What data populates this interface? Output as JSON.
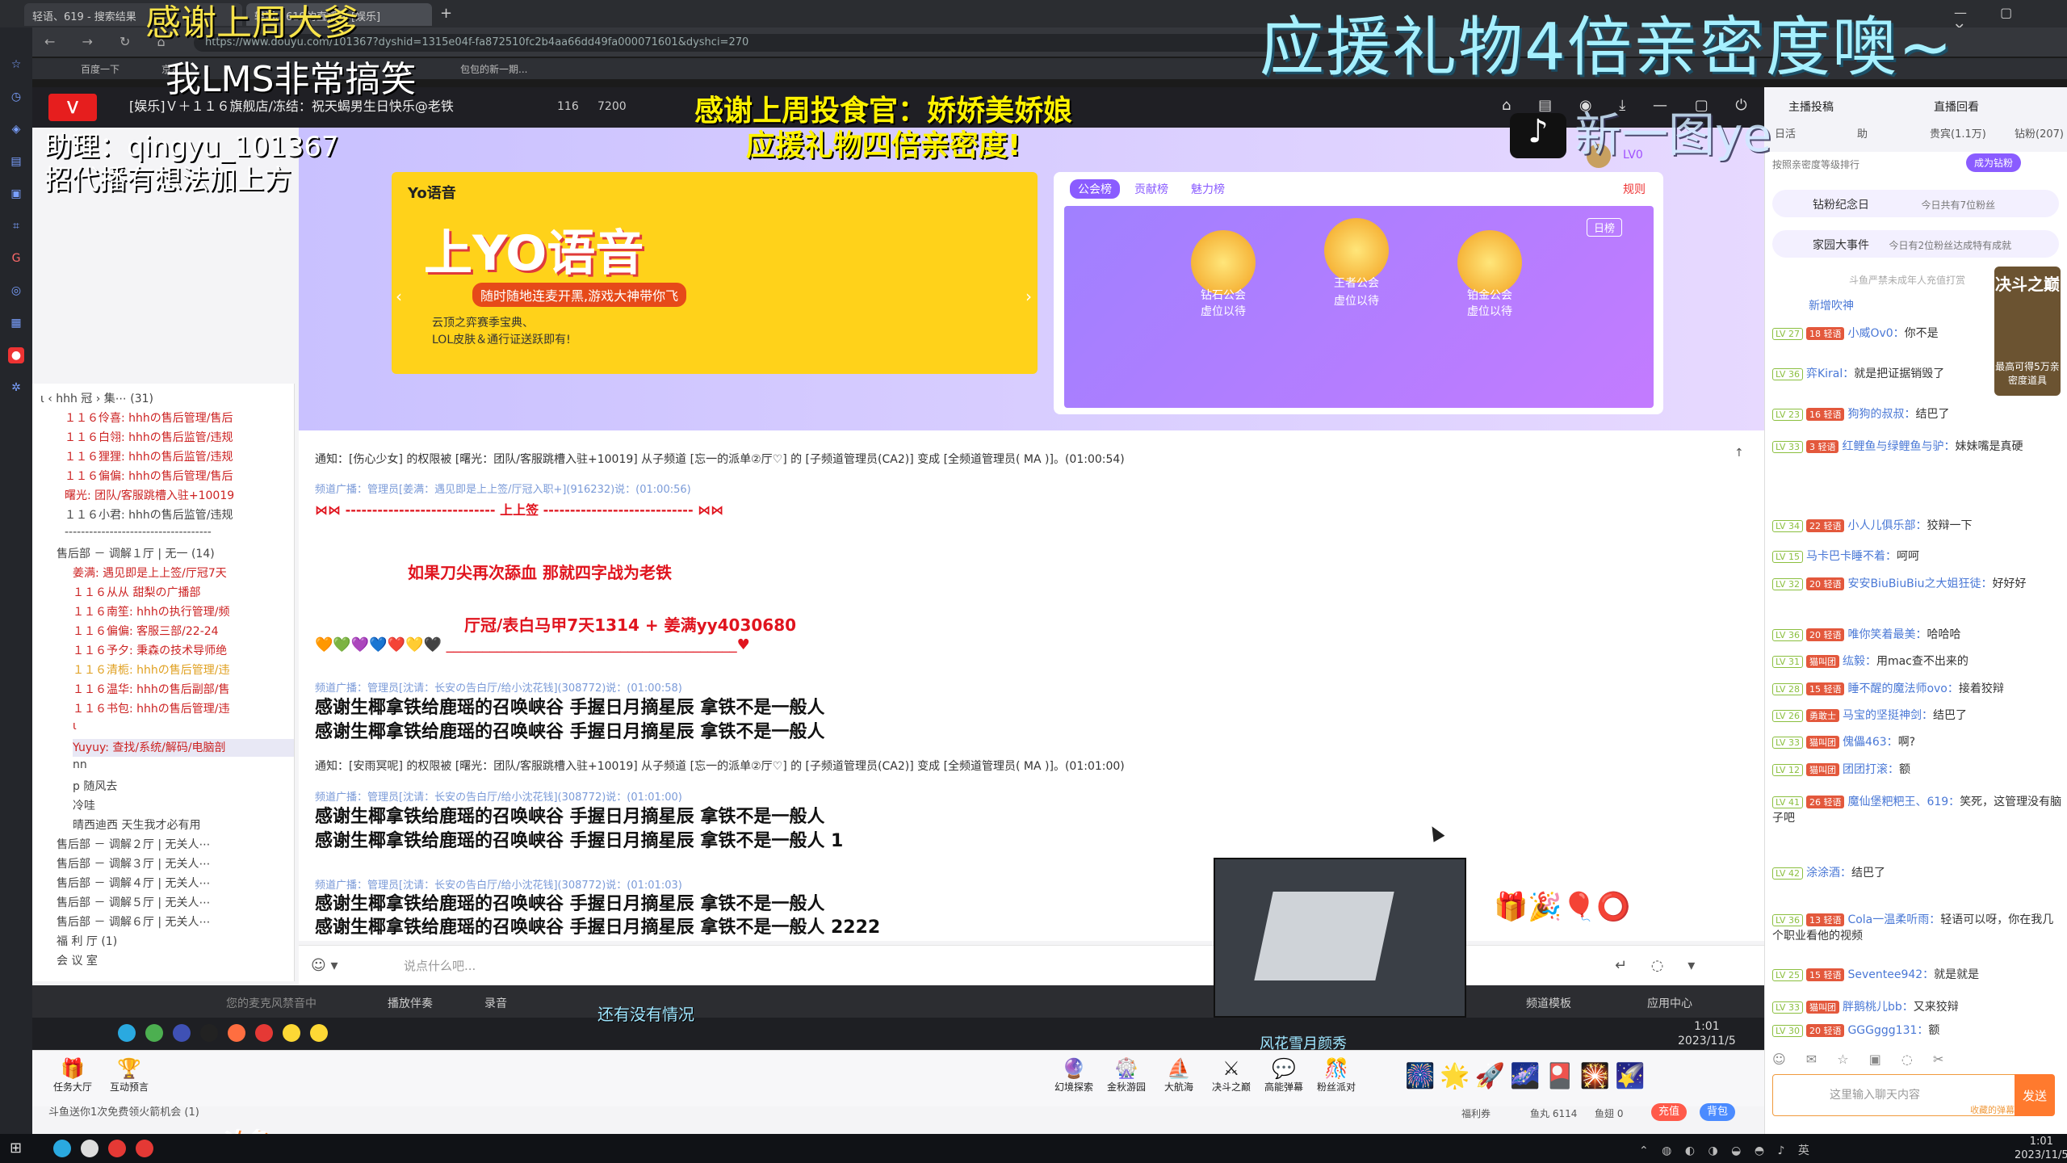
{
  "browser": {
    "tabs": [
      "轻语、619 - 搜索结果",
      "轻语、619的直播间 [娱乐]"
    ],
    "url": "https://www.douyu.com/101367?dyshid=1315e04f-fa872510fc2b4aa66dd49fa000071601&dyshci=270",
    "bookmarks": [
      "百度一下",
      "京东",
      "包包的新一期..."
    ]
  },
  "overlays": {
    "top_left_line1": "感谢上周大爹",
    "top_left_line2": "我LMS非常搞笑",
    "top_right": "应援礼物4倍亲密度噢~",
    "banner_line1": "感谢上周投食官：娇娇美娇娘",
    "banner_line2": "应援礼物四倍亲密度!",
    "assistant_line1": "助理：qingyu_101367",
    "assistant_line2": "招代播有想法加上方",
    "tiktok_text": "新一图ye",
    "subtitle": "还有没有情况",
    "webcam_caption": "风花雪月颜秀"
  },
  "room": {
    "title": "[娱乐]Ｖ＋１１６旗舰店/冻结：祝天蝎男生日快乐@老铁",
    "hot": "116",
    "followers": "7200",
    "level": "LV0"
  },
  "ad": {
    "brand": "Yo语音",
    "headline": "上YO语音",
    "sub": "随时随地连麦开黑,游戏大神带你飞",
    "desc1": "云顶之弈赛季宝典、",
    "desc2": "LOL皮肤＆通行证送跃即有!"
  },
  "rank": {
    "tabs": [
      "公会榜",
      "贡献榜",
      "魅力榜"
    ],
    "rules": "规则",
    "period": "日榜",
    "badges": [
      "钻石公会",
      "王者公会",
      "铂金公会"
    ],
    "badge_sub": "虚位以待"
  },
  "userlist": {
    "header": "ι     ‹ hhh 冠 ›     集⋯  (31)",
    "rows": [
      "１１６伶喜: hhhの售后管理/售后",
      "１１６白翎: hhhの售后监管/违规",
      "１１６狸狸: hhhの售后监管/违规",
      "１１６偏偏: hhhの售后管理/售后",
      "曙光: 团队/客服跳槽入驻+10019",
      "１１６小君: hhhの售后监管/违规",
      "------------------------------------",
      "售后部 － 调解１厅  | 无一 (14)",
      "姜满: 遇见即是上上签/厅冠7天",
      "１１６从从 甜梨の广播部",
      "１１６南笙: hhhの执行管理/频",
      "１１６偏偏: 客服三部/22-24",
      "１１６予夕: 秉森の技术导师绝",
      "１１６清栀: hhhの售后管理/违",
      "１１６温华: hhhの售后副部/售",
      "１１６书包: hhhの售后管理/违",
      "ι",
      "Yuyuy: 查找/系统/解码/电脑剖",
      "nn",
      "p  随风去",
      "冷哇",
      "晴西迪西    天生我才必有用",
      "售后部 － 调解２厅  | 无关人⋯",
      "售后部 － 调解３厅  | 无关人⋯",
      "售后部 － 调解４厅  | 无关人⋯",
      "售后部 － 调解５厅  | 无关人⋯",
      "售后部 － 调解６厅  | 无关人⋯",
      "福  利  厅         (1)",
      "会  议  室"
    ]
  },
  "chat": {
    "notice1": "通知：[伤心少女] 的权限被 [曙光：团队/客服跳槽入驻+10019] 从子频道 [忘一的派单②厅♡] 的 [子频道管理员(CA2)] 变成 [全频道管理员( MA )]。(01:00:54)",
    "broad1": "频道广播：管理员[姜满：遇见即是上上签/厅冠入职+](916232)说：(01:00:56)",
    "sign": "⋈⋈   ----------------------------  上上签  ----------------------------   ⋈⋈",
    "red1": "如果刀尖再次舔血  那就四字战为老铁",
    "red2": "厅冠/表白马甲7天1314 + 姜满yy4030680",
    "hearts": "🧡💚💜💙❤️💛🖤 ________________________________________♥",
    "broad2": "频道广播：管理员[沈请：长安の告白厅/给小沈花钱](308772)说：(01:00:58)",
    "big1": "感谢生椰拿铁给鹿瑶的召唤峡谷  手握日月摘星辰  拿铁不是一般人",
    "big2": "感谢生椰拿铁给鹿瑶的召唤峡谷  手握日月摘星辰  拿铁不是一般人",
    "notice2": "通知：[安雨冥呢] 的权限被 [曙光：团队/客服跳槽入驻+10019] 从子频道 [忘一的派单②厅♡] 的 [子频道管理员(CA2)] 变成 [全频道管理员( MA )]。(01:01:00)",
    "broad3": "频道广播：管理员[沈请：长安の告白厅/给小沈花钱](308772)说：(01:01:00)",
    "big3": "感谢生椰拿铁给鹿瑶的召唤峡谷  手握日月摘星辰  拿铁不是一般人",
    "big4": "感谢生椰拿铁给鹿瑶的召唤峡谷  手握日月摘星辰  拿铁不是一般人 1",
    "broad4": "频道广播：管理员[沈请：长安の告白厅/给小沈花钱](308772)说：(01:01:03)",
    "big5": "感谢生椰拿铁给鹿瑶的召唤峡谷  手握日月摘星辰  拿铁不是一般人",
    "big6": "感谢生椰拿铁给鹿瑶的召唤峡谷  手握日月摘星辰  拿铁不是一般人 2222",
    "composer_placeholder": "说点什么吧..."
  },
  "bottom_bar": {
    "mic": "您的麦克风禁音中",
    "music": "播放伴奏",
    "record": "录音",
    "channel_mode": "频道模板",
    "app_center": "应用中心"
  },
  "inner_clock": {
    "time": "1:01",
    "date": "2023/11/5"
  },
  "gifts": {
    "task": "任务大厅",
    "interact": "互动预言",
    "items": [
      "幻境探索",
      "金秋游园",
      "大航海",
      "决斗之巅",
      "高能弹幕",
      "粉丝派对"
    ],
    "free_gift": "斗鱼送你1次免费领火箭机会 (1)"
  },
  "right_panel": {
    "top_tabs": [
      "主播投稿",
      "直播回看"
    ],
    "tabs": [
      "日活",
      "助",
      "贵宾(1.1万)",
      "钻粉(207)"
    ],
    "intimacy": "按照亲密度等级排行",
    "become_fan": "成为钻粉",
    "anniv_title": "钻粉纪念日",
    "anniv_value": "今日共有7位粉丝",
    "family_title": "家园大事件",
    "family_value": "今日有2位粉丝达成特有成就",
    "warning": "斗鱼严禁未成年人充值打赏",
    "fight_title": "决斗之巅",
    "fight_sub": "最高可得5万亲密度道具",
    "messages": [
      {
        "lv": "",
        "fan": "",
        "name": "新增吹神",
        "text": ""
      },
      {
        "lv": "LV 27",
        "fan": "18 轻语",
        "name": "小威Ov0：",
        "text": "你不是"
      },
      {
        "lv": "LV 36",
        "fan": "",
        "name": "弈Kiral：",
        "text": "就是把证据销毁了"
      },
      {
        "lv": "LV 23",
        "fan": "16 轻语",
        "name": "狗狗的叔叔：",
        "text": "结巴了"
      },
      {
        "lv": "LV 33",
        "fan": "3 轻语",
        "name": "红鲤鱼与绿鲤鱼与驴：",
        "text": "妹妹嘴是真硬"
      },
      {
        "lv": "LV 34",
        "fan": "22 轻语",
        "name": "小人儿俱乐部：",
        "text": "狡辩一下"
      },
      {
        "lv": "LV 15",
        "fan": "",
        "name": "马卡巴卡睡不着：",
        "text": "呵呵"
      },
      {
        "lv": "LV 32",
        "fan": "20 轻语",
        "name": "安安BiuBiuBiu之大姐狂徒：",
        "text": "好好好"
      },
      {
        "lv": "LV 36",
        "fan": "20 轻语",
        "name": "唯你笑着最美：",
        "text": "哈哈哈"
      },
      {
        "lv": "LV 31",
        "fan": "猫叫团",
        "name": "纮毅：",
        "text": "用mac查不出来的"
      },
      {
        "lv": "LV 28",
        "fan": "15 轻语",
        "name": "睡不醒的魔法师ovo：",
        "text": "接着狡辩"
      },
      {
        "lv": "LV 26",
        "fan": "勇敢士",
        "name": "马宝的坚挺神剑：",
        "text": "结巴了"
      },
      {
        "lv": "LV 33",
        "fan": "猫叫团",
        "name": "傀儡463：",
        "text": "啊?"
      },
      {
        "lv": "LV 12",
        "fan": "猫叫团",
        "name": "团团打滚：",
        "text": "额"
      },
      {
        "lv": "LV 41",
        "fan": "26 轻语",
        "name": "魔仙堡粑粑王、619：",
        "text": "笑死，这管理没有脑子吧"
      },
      {
        "lv": "LV 42",
        "fan": "",
        "name": "涂涂酒：",
        "text": "结巴了"
      },
      {
        "lv": "LV 36",
        "fan": "13 轻语",
        "name": "Cola一温柔听雨：",
        "text": "轻语可以呀，你在我几个职业看他的视频"
      },
      {
        "lv": "LV 25",
        "fan": "15 轻语",
        "name": "Seventee942：",
        "text": "就是就是"
      },
      {
        "lv": "LV 33",
        "fan": "猫叫团",
        "name": "胖鹅桃儿bb：",
        "text": "又来狡辩"
      },
      {
        "lv": "LV 30",
        "fan": "20 轻语",
        "name": "GGGggg131：",
        "text": "额"
      }
    ],
    "input_placeholder": "这里输入聊天内容",
    "send": "发送",
    "welfare": "福利券",
    "fish_ball": "鱼丸 6114",
    "fish_wing": "鱼翅 0",
    "charge": "充值",
    "backpack": "背包",
    "bonus": "收藏的弹幕"
  },
  "os": {
    "time": "1:01",
    "date": "2023/11/5",
    "logo": "斗鱼"
  }
}
